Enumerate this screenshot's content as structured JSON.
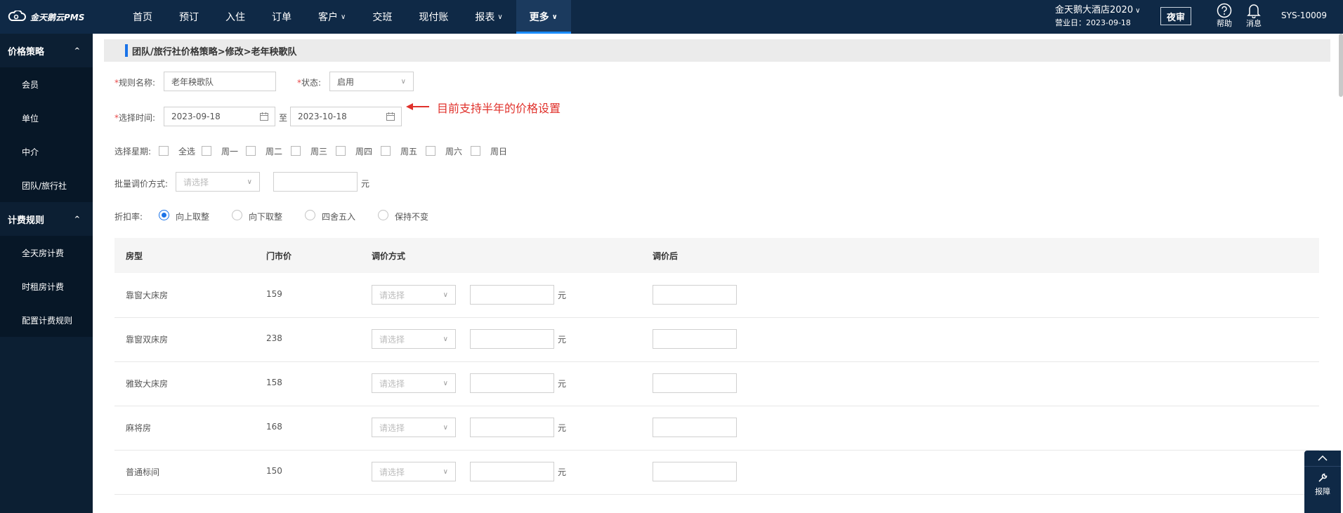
{
  "app": {
    "logo_text": "金天鹅云PMS",
    "brand_color": "#0f2946",
    "accent_color": "#1a73e8"
  },
  "nav": {
    "items": [
      {
        "label": "首页",
        "has_dropdown": false,
        "active": false
      },
      {
        "label": "预订",
        "has_dropdown": false,
        "active": false
      },
      {
        "label": "入住",
        "has_dropdown": false,
        "active": false
      },
      {
        "label": "订单",
        "has_dropdown": false,
        "active": false
      },
      {
        "label": "客户",
        "has_dropdown": true,
        "active": false
      },
      {
        "label": "交班",
        "has_dropdown": false,
        "active": false
      },
      {
        "label": "现付账",
        "has_dropdown": false,
        "active": false
      },
      {
        "label": "报表",
        "has_dropdown": true,
        "active": false
      },
      {
        "label": "更多",
        "has_dropdown": true,
        "active": true
      }
    ],
    "dropdown_glyph": "∨"
  },
  "header": {
    "hotel_name": "金天鹅大酒店2020",
    "business_date": "营业日：2023-09-18",
    "night_audit_label": "夜审",
    "help_label": "帮助",
    "message_label": "消息",
    "user_id": "SYS-10009",
    "help_icon": "help-circle-icon",
    "message_icon": "bell-icon"
  },
  "sidebar": {
    "groups": [
      {
        "label": "价格策略",
        "expanded": true,
        "items": [
          "会员",
          "单位",
          "中介",
          "团队/旅行社"
        ]
      },
      {
        "label": "计费规则",
        "expanded": true,
        "items": [
          "全天房计费",
          "时租房计费",
          "配置计费规则"
        ]
      }
    ],
    "caret_glyph": "^"
  },
  "breadcrumb": "团队/旅行社价格策略>修改>老年秧歌队",
  "form": {
    "rule_name_label": "规则名称:",
    "rule_name_value": "老年秧歌队",
    "status_label": "状态:",
    "status_value": "启用",
    "time_label": "选择时间:",
    "date_start": "2023-09-18",
    "date_end": "2023-10-18",
    "date_sep": "至",
    "annotation": "目前支持半年的价格设置",
    "weekday_label": "选择星期:",
    "weekdays": [
      "全选",
      "周一",
      "周二",
      "周三",
      "周四",
      "周五",
      "周六",
      "周日"
    ],
    "batch_label": "批量调价方式:",
    "batch_placeholder": "请选择",
    "batch_unit": "元",
    "discount_label": "折扣率:",
    "rounding_options": [
      {
        "label": "向上取整",
        "checked": true
      },
      {
        "label": "向下取整",
        "checked": false
      },
      {
        "label": "四舍五入",
        "checked": false
      },
      {
        "label": "保持不变",
        "checked": false
      }
    ]
  },
  "table": {
    "headers": [
      "房型",
      "门市价",
      "调价方式",
      "调价后"
    ],
    "select_placeholder": "请选择",
    "unit": "元",
    "rows": [
      {
        "room_type": "靠窗大床房",
        "rack_price": "159"
      },
      {
        "room_type": "靠窗双床房",
        "rack_price": "238"
      },
      {
        "room_type": "雅致大床房",
        "rack_price": "158"
      },
      {
        "room_type": "麻将房",
        "rack_price": "168"
      },
      {
        "room_type": "普通标间",
        "rack_price": "150"
      }
    ]
  },
  "float_widget": {
    "label": "报障",
    "up_icon": "chevron-up-icon",
    "wrench_icon": "wrench-icon"
  }
}
